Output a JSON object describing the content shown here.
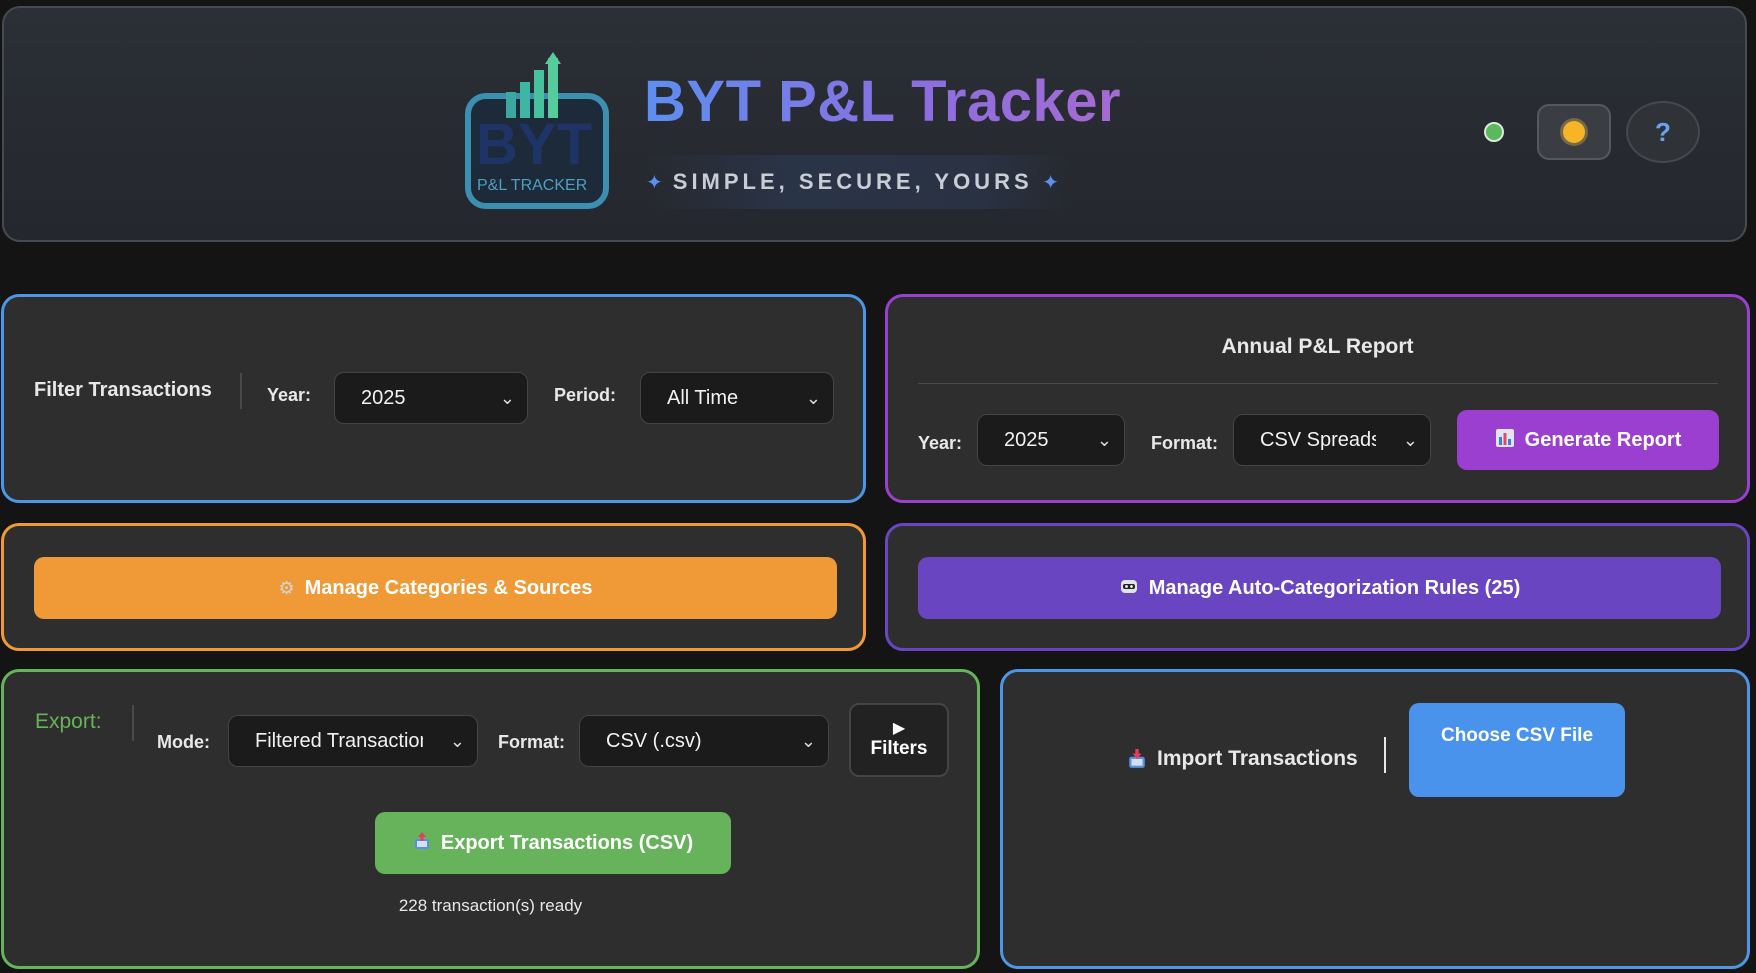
{
  "header": {
    "logo_text": "BYT",
    "logo_subtitle": "P&L TRACKER",
    "title": "BYT P&L Tracker",
    "tagline": "SIMPLE, SECURE, YOURS",
    "tagline_star": "✦",
    "status_color": "#5cb85c",
    "theme_icon": "sun-icon",
    "help_label": "?"
  },
  "filter": {
    "title": "Filter Transactions",
    "year_label": "Year:",
    "year_value": "2025",
    "period_label": "Period:",
    "period_value": "All Time"
  },
  "annual": {
    "title": "Annual P&L Report",
    "year_label": "Year:",
    "year_value": "2025",
    "format_label": "Format:",
    "format_value": "CSV Spreadsl",
    "generate_label": "Generate Report",
    "generate_icon": "chart-icon"
  },
  "categories": {
    "button_label": "Manage Categories & Sources",
    "icon": "gear-icon"
  },
  "rules": {
    "button_label": "Manage Auto-Categorization Rules (25)",
    "icon": "robot-icon"
  },
  "export": {
    "title": "Export:",
    "mode_label": "Mode:",
    "mode_value": "Filtered Transaction",
    "format_label": "Format:",
    "format_value": "CSV (.csv)",
    "filters_arrow": "▶",
    "filters_label": "Filters",
    "export_label": "Export Transactions (CSV)",
    "export_icon": "outbox-icon",
    "ready_text": "228 transaction(s) ready"
  },
  "import": {
    "title": "Import Transactions",
    "icon": "inbox-icon",
    "choose_label": "Choose CSV File"
  },
  "colors": {
    "filter_border": "#4d95e6",
    "annual_border": "#9a3fd0",
    "categories": "#ef9a36",
    "rules": "#6a45c2",
    "export": "#67b35b",
    "import_button": "#4a93ec",
    "generate": "#9a3fd0"
  }
}
